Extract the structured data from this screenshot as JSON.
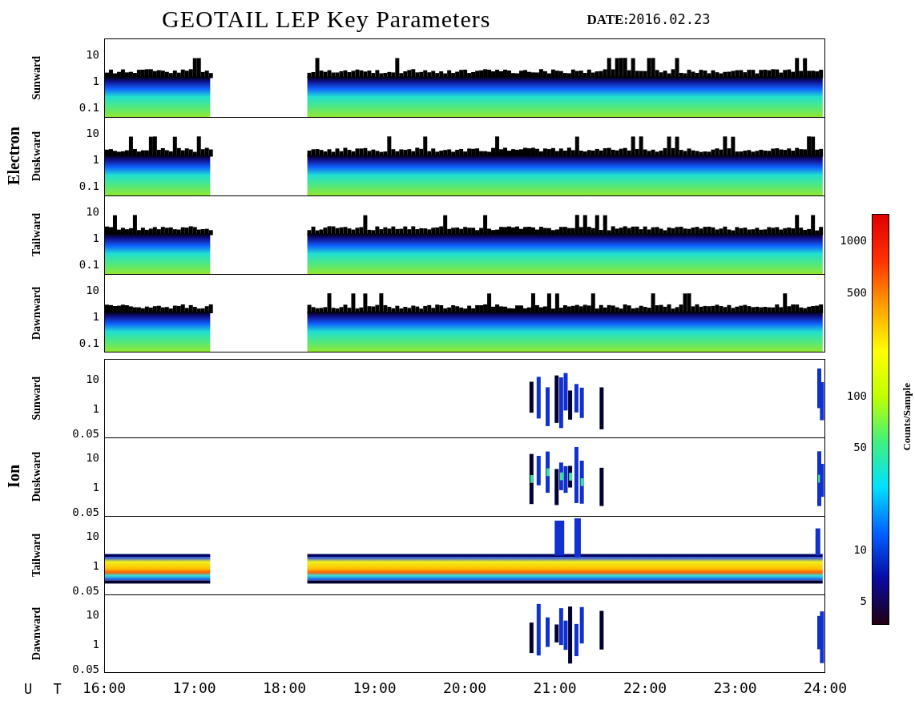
{
  "title": "GEOTAIL LEP Key Parameters",
  "date_label": "DATE:",
  "date": "2016.02.23",
  "groups": [
    {
      "species": "Electron",
      "panels": [
        {
          "direction": "Sunward",
          "kind": "electron",
          "yticks": [
            "10",
            "1",
            "0.1"
          ]
        },
        {
          "direction": "Duskward",
          "kind": "electron",
          "yticks": [
            "10",
            "1",
            "0.1"
          ]
        },
        {
          "direction": "Tailward",
          "kind": "electron",
          "yticks": [
            "10",
            "1",
            "0.1"
          ]
        },
        {
          "direction": "Dawnward",
          "kind": "electron",
          "yticks": [
            "10",
            "1",
            "0.1"
          ]
        }
      ]
    },
    {
      "species": "Ion",
      "panels": [
        {
          "direction": "Sunward",
          "kind": "ion",
          "yticks": [
            "10",
            "1",
            "0.05"
          ]
        },
        {
          "direction": "Duskward",
          "kind": "ion",
          "yticks": [
            "10",
            "1",
            "0.05"
          ]
        },
        {
          "direction": "Tailward",
          "kind": "ion-band",
          "yticks": [
            "10",
            "1",
            "0.05"
          ]
        },
        {
          "direction": "Dawnward",
          "kind": "ion",
          "yticks": [
            "10",
            "1",
            "0.05"
          ]
        }
      ]
    }
  ],
  "x_axis": {
    "label": "U T",
    "ticks": [
      "16:00",
      "17:00",
      "18:00",
      "19:00",
      "20:00",
      "21:00",
      "22:00",
      "23:00",
      "24:00"
    ]
  },
  "colorbar": {
    "label": "Counts/Sample",
    "ticks": [
      "1000",
      "500",
      "100",
      "50",
      "10",
      "5"
    ]
  }
}
